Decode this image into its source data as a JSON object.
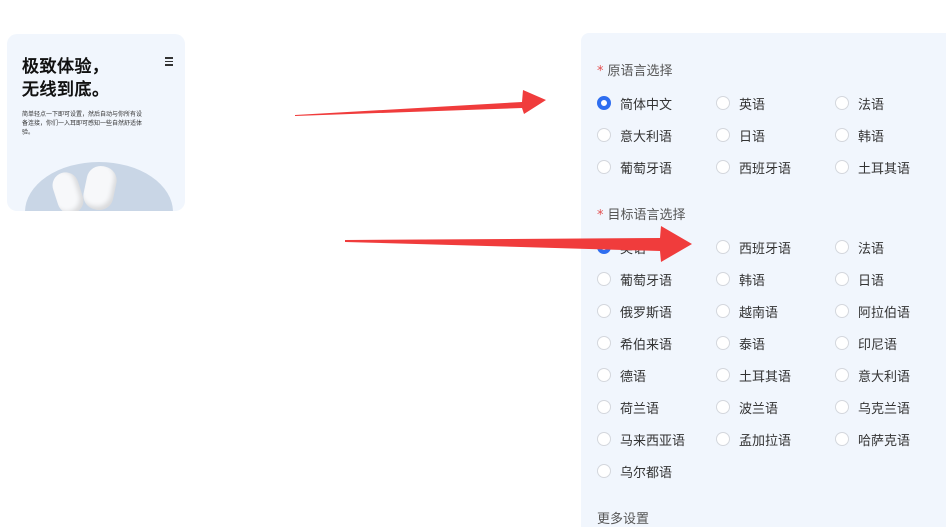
{
  "thumbnail": {
    "title_line1": "极致体验，",
    "title_line2": "无线到底。",
    "desc": "简单轻点一下即可设置，然后自动与你所有设备连接，你们一入耳即可感知一些自然舒适体验。",
    "menu_icon": "hamburger-menu-icon"
  },
  "source_language": {
    "required_mark": "*",
    "title": "原语言选择",
    "options": [
      "简体中文",
      "英语",
      "法语",
      "意大利语",
      "日语",
      "韩语",
      "葡萄牙语",
      "西班牙语",
      "土耳其语"
    ],
    "selected": "简体中文"
  },
  "target_language": {
    "required_mark": "*",
    "title": "目标语言选择",
    "options": [
      "英语",
      "西班牙语",
      "法语",
      "葡萄牙语",
      "韩语",
      "日语",
      "俄罗斯语",
      "越南语",
      "阿拉伯语",
      "希伯来语",
      "泰语",
      "印尼语",
      "德语",
      "土耳其语",
      "意大利语",
      "荷兰语",
      "波兰语",
      "乌克兰语",
      "马来西亚语",
      "孟加拉语",
      "哈萨克语",
      "乌尔都语"
    ],
    "selected": "英语"
  },
  "more_settings": "更多设置",
  "colors": {
    "accent": "#2f6ef0",
    "arrow": "#f03c3c",
    "panel_bg": "#f1f6fd",
    "required": "#e34d4d"
  }
}
